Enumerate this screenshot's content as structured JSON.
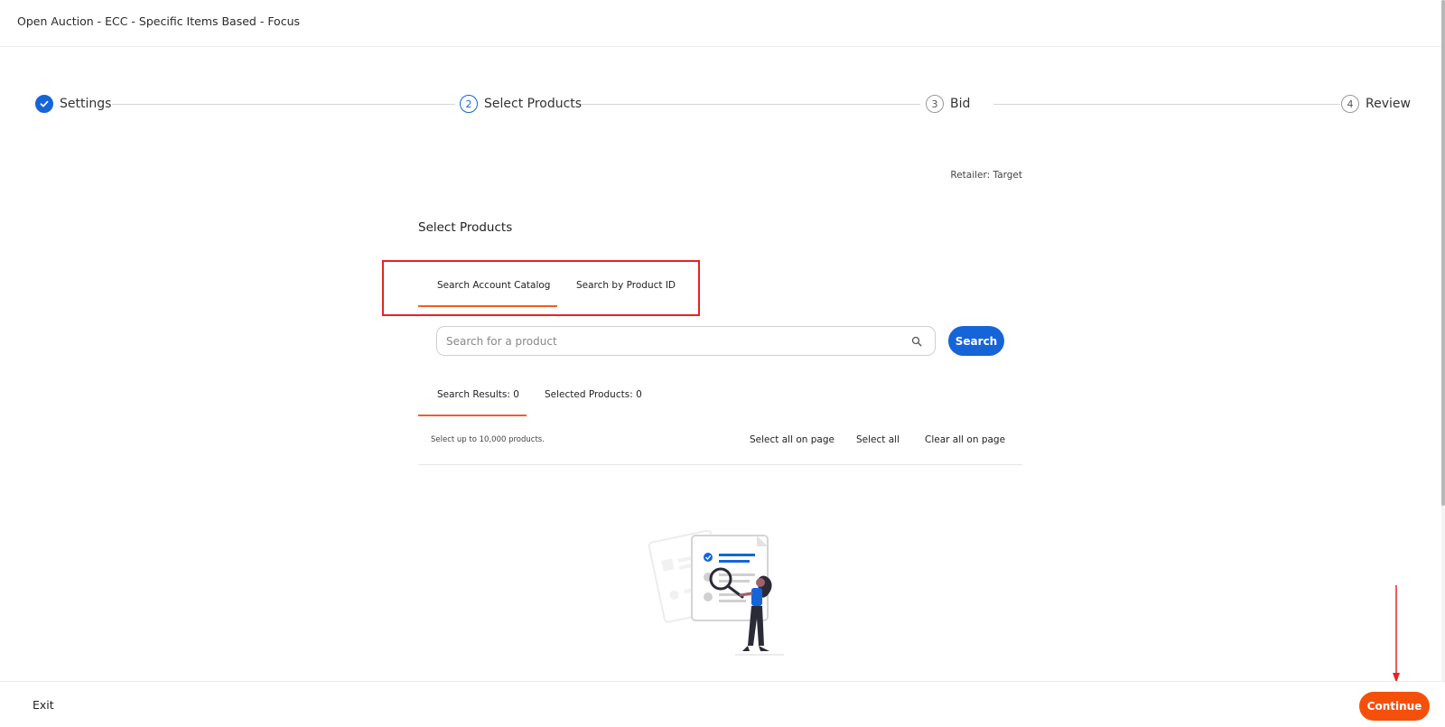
{
  "header": {
    "title": "Open Auction - ECC - Specific Items Based - Focus"
  },
  "stepper": {
    "steps": [
      {
        "number": "1",
        "label": "Settings",
        "state": "completed"
      },
      {
        "number": "2",
        "label": "Select Products",
        "state": "active"
      },
      {
        "number": "3",
        "label": "Bid",
        "state": "upcoming"
      },
      {
        "number": "4",
        "label": "Review",
        "state": "upcoming"
      }
    ]
  },
  "retailer_label": "Retailer: Target",
  "section_title": "Select Products",
  "search_tabs": [
    {
      "label": "Search Account Catalog",
      "selected": true
    },
    {
      "label": "Search by Product ID",
      "selected": false
    }
  ],
  "search": {
    "placeholder": "Search for a product",
    "value": "",
    "button_label": "Search"
  },
  "result_tabs": [
    {
      "label": "Search Results: 0",
      "selected": true
    },
    {
      "label": "Selected Products: 0",
      "selected": false
    }
  ],
  "selection": {
    "note": "Select up to 10,000 products.",
    "select_all_on_page": "Select all on page",
    "select_all": "Select all",
    "clear_all_on_page": "Clear all on page"
  },
  "footer": {
    "exit_label": "Exit",
    "continue_label": "Continue"
  },
  "colors": {
    "primary_blue": "#1565d8",
    "accent_orange": "#f5500a",
    "tab_underline": "#f06020",
    "annotation_red": "#e82222"
  }
}
